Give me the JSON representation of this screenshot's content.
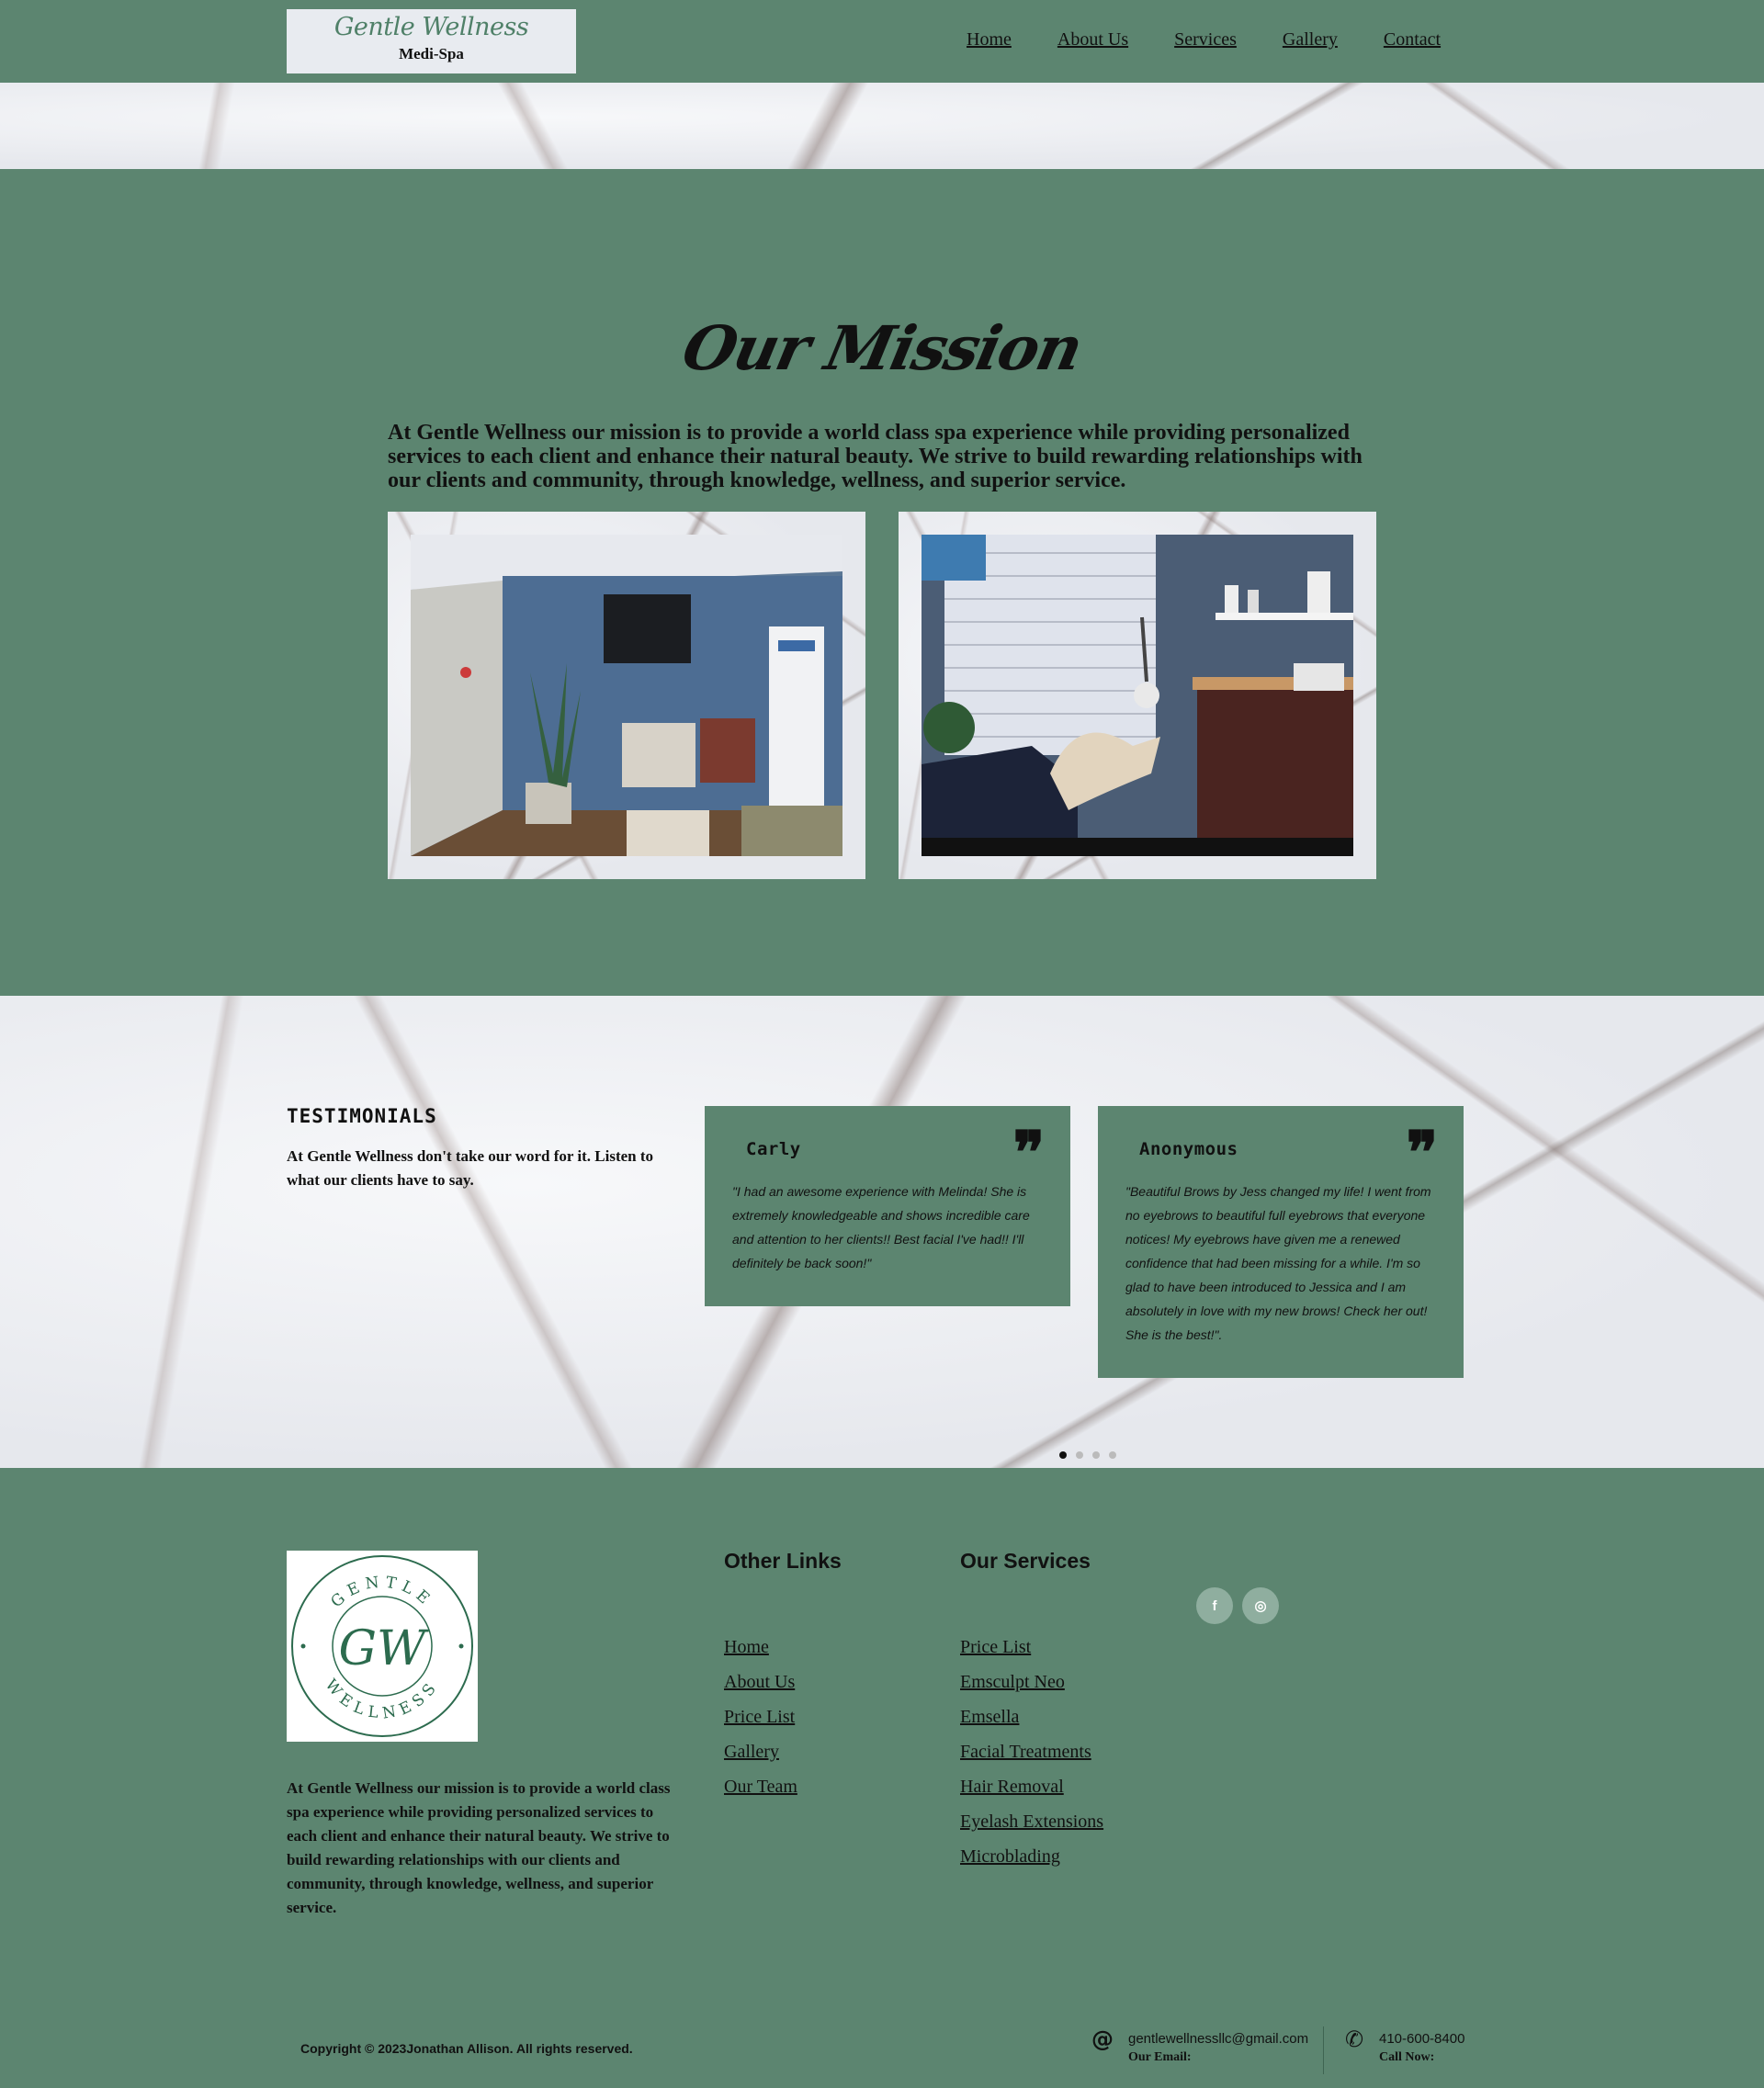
{
  "header": {
    "logo_script": "Gentle Wellness",
    "logo_sub": "Medi-Spa",
    "nav": [
      "Home",
      "About Us",
      "Services",
      "Gallery",
      "Contact"
    ]
  },
  "mission": {
    "title": "Our Mission",
    "text": "At Gentle Wellness our mission is to provide a world class spa experience while providing personalized services to each client and enhance their natural beauty. We strive to build rewarding relationships with our clients and community, through knowledge, wellness, and superior service."
  },
  "testimonials": {
    "title": "TESTIMONIALS",
    "subtitle": "At Gentle Wellness don't take our word for it. Listen to what our clients have to say.",
    "cards": [
      {
        "name": "Carly",
        "text": "\"I had an awesome experience with Melinda! She is extremely knowledgeable and shows incredible care and attention to her clients!! Best facial I've had!! I'll definitely be back soon!\""
      },
      {
        "name": "Anonymous",
        "text": "\"Beautiful Brows by Jess changed my life! I went from no eyebrows to beautiful full eyebrows that everyone notices! My eyebrows have given me a renewed confidence that had been missing for a while. I'm so glad to have been introduced to Jessica and I am absolutely in love with my new brows! Check her out! She is the best!\"."
      }
    ],
    "quote_mark": "❞"
  },
  "footer": {
    "logo_top": "GENTLE",
    "logo_mono": "GW",
    "logo_bottom": "WELLNESS",
    "about": "At Gentle Wellness our mission is to provide a world class spa experience while providing personalized services to each client and enhance their natural beauty. We strive to build rewarding relationships with our clients and community, through knowledge, wellness, and superior service.",
    "other_links_title": "Other Links",
    "other_links": [
      "Home",
      "About Us",
      "Price List",
      "Gallery",
      "Our Team"
    ],
    "services_title": "Our Services",
    "services": [
      "Price List",
      "Emsculpt Neo",
      "Emsella",
      "Facial Treatments",
      "Hair Removal",
      "Eyelash Extensions",
      "Microblading"
    ],
    "social": {
      "facebook": "f",
      "instagram": "◎"
    },
    "copyright": "Copyright © 2023Jonathan Allison. All rights reserved.",
    "email": "gentlewellnessllc@gmail.com",
    "email_label": "Our Email:",
    "phone": "410-600-8400",
    "phone_label": "Call Now:",
    "email_icon": "@",
    "phone_icon": "✆"
  },
  "colors": {
    "brand_green": "#5c8570",
    "marble": "#eceef2",
    "text": "#111111"
  }
}
